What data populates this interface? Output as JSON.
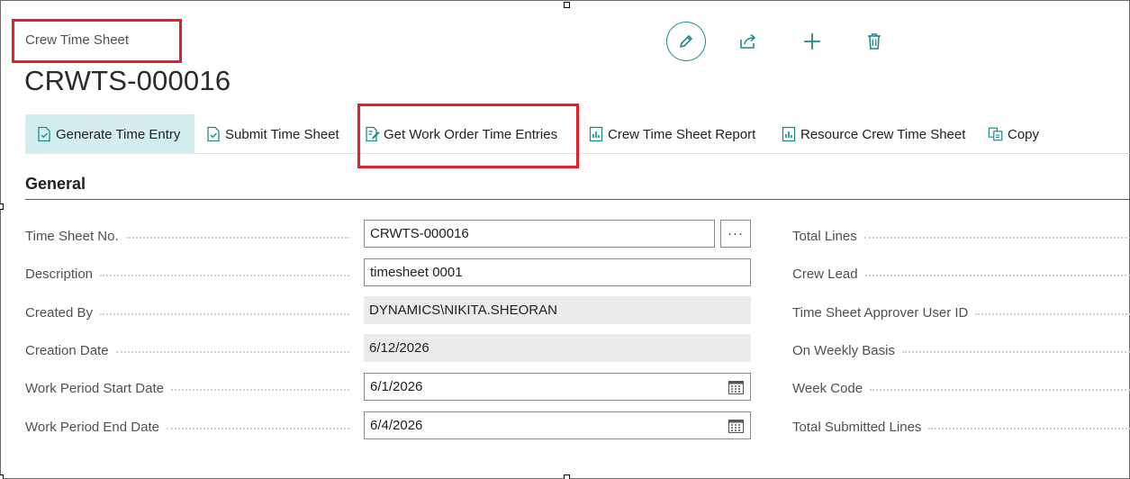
{
  "header": {
    "caption": "Crew Time Sheet",
    "record_no": "CRWTS-000016"
  },
  "top_actions": {
    "edit_icon": "pencil-icon",
    "share_icon": "share-icon",
    "new_icon": "plus-icon",
    "delete_icon": "trash-icon"
  },
  "actions": [
    {
      "label": "Generate Time Entry",
      "icon": "document-check-icon"
    },
    {
      "label": "Submit Time Sheet",
      "icon": "document-check-icon"
    },
    {
      "label": "Get Work Order Time Entries",
      "icon": "document-edit-icon"
    },
    {
      "label": "Crew Time Sheet Report",
      "icon": "report-icon"
    },
    {
      "label": "Resource Crew Time Sheet",
      "icon": "report-icon"
    },
    {
      "label": "Copy",
      "icon": "copy-icon"
    }
  ],
  "section": {
    "title": "General"
  },
  "fields_left": [
    {
      "label": "Time Sheet No.",
      "value": "CRWTS-000016"
    },
    {
      "label": "Description",
      "value": "timesheet 0001"
    },
    {
      "label": "Created By",
      "value": "DYNAMICS\\NIKITA.SHEORAN"
    },
    {
      "label": "Creation Date",
      "value": "6/12/2026"
    },
    {
      "label": "Work Period Start Date",
      "value": "6/1/2026"
    },
    {
      "label": "Work Period End Date",
      "value": "6/4/2026"
    }
  ],
  "lookup_button": "···",
  "fields_right": [
    {
      "label": "Total Lines"
    },
    {
      "label": "Crew Lead"
    },
    {
      "label": "Time Sheet Approver User ID"
    },
    {
      "label": "On Weekly Basis"
    },
    {
      "label": "Week Code"
    },
    {
      "label": "Total Submitted Lines"
    }
  ],
  "colors": {
    "accent": "#1a8a8a",
    "active_action_bg": "#d4eef0",
    "annotation_red": "#e0202a"
  }
}
